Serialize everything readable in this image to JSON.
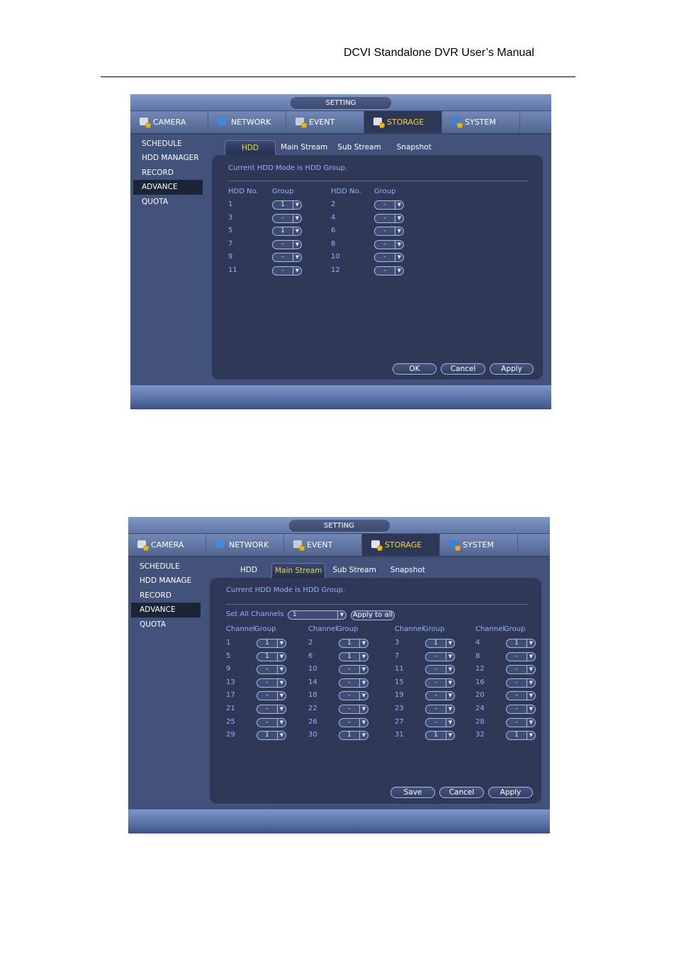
{
  "document": {
    "header": "DCVI Standalone DVR User’s Manual"
  },
  "screens": [
    {
      "title": "SETTING",
      "main_tabs": [
        {
          "label": "CAMERA",
          "icon": "camera-icon"
        },
        {
          "label": "NETWORK",
          "icon": "network-icon"
        },
        {
          "label": "EVENT",
          "icon": "event-icon"
        },
        {
          "label": "STORAGE",
          "icon": "storage-icon",
          "active": true
        },
        {
          "label": "SYSTEM",
          "icon": "system-icon"
        }
      ],
      "side_menu": [
        "SCHEDULE",
        "HDD MANAGER",
        "RECORD",
        "ADVANCE",
        "QUOTA"
      ],
      "side_active": "ADVANCE",
      "sub_tabs": [
        "HDD",
        "Main Stream",
        "Sub Stream",
        "Snapshot"
      ],
      "sub_active": "HDD",
      "mode_text": "Current HDD Mode is HDD Group.",
      "col_headers": {
        "no": "HDD No.",
        "group": "Group"
      },
      "rows": [
        {
          "a_no": "1",
          "a_group": "1",
          "b_no": "2",
          "b_group": "-"
        },
        {
          "a_no": "3",
          "a_group": "-",
          "b_no": "4",
          "b_group": "-"
        },
        {
          "a_no": "5",
          "a_group": "1",
          "b_no": "6",
          "b_group": "-"
        },
        {
          "a_no": "7",
          "a_group": "-",
          "b_no": "8",
          "b_group": "-"
        },
        {
          "a_no": "9",
          "a_group": "-",
          "b_no": "10",
          "b_group": "-"
        },
        {
          "a_no": "11",
          "a_group": "-",
          "b_no": "12",
          "b_group": "-"
        }
      ],
      "buttons": {
        "ok": "OK",
        "cancel": "Cancel",
        "apply": "Apply"
      }
    },
    {
      "title": "SETTING",
      "main_tabs": [
        {
          "label": "CAMERA",
          "icon": "camera-icon"
        },
        {
          "label": "NETWORK",
          "icon": "network-icon"
        },
        {
          "label": "EVENT",
          "icon": "event-icon"
        },
        {
          "label": "STORAGE",
          "icon": "storage-icon",
          "active": true
        },
        {
          "label": "SYSTEM",
          "icon": "system-icon"
        }
      ],
      "side_menu": [
        "SCHEDULE",
        "HDD MANAGE",
        "RECORD",
        "ADVANCE",
        "QUOTA"
      ],
      "side_active": "ADVANCE",
      "sub_tabs": [
        "HDD",
        "Main Stream",
        "Sub Stream",
        "Snapshot"
      ],
      "sub_active": "Main Stream",
      "mode_text": "Current HDD Mode is HDD Group.",
      "set_all": {
        "label": "Set All Channels",
        "value": "1",
        "apply_label": "Apply to all"
      },
      "col_headers": {
        "channel": "Channel",
        "group": "Group"
      },
      "channels": [
        {
          "ch": "1",
          "group": "1"
        },
        {
          "ch": "2",
          "group": "1"
        },
        {
          "ch": "3",
          "group": "1"
        },
        {
          "ch": "4",
          "group": "1"
        },
        {
          "ch": "5",
          "group": "1"
        },
        {
          "ch": "6",
          "group": "1"
        },
        {
          "ch": "7",
          "group": "-"
        },
        {
          "ch": "8",
          "group": "-"
        },
        {
          "ch": "9",
          "group": "-"
        },
        {
          "ch": "10",
          "group": "-"
        },
        {
          "ch": "11",
          "group": "-"
        },
        {
          "ch": "12",
          "group": "-"
        },
        {
          "ch": "13",
          "group": "-"
        },
        {
          "ch": "14",
          "group": "-"
        },
        {
          "ch": "15",
          "group": "-"
        },
        {
          "ch": "16",
          "group": "-"
        },
        {
          "ch": "17",
          "group": "-"
        },
        {
          "ch": "18",
          "group": "-"
        },
        {
          "ch": "19",
          "group": "-"
        },
        {
          "ch": "20",
          "group": "-"
        },
        {
          "ch": "21",
          "group": "-"
        },
        {
          "ch": "22",
          "group": "-"
        },
        {
          "ch": "23",
          "group": "-"
        },
        {
          "ch": "24",
          "group": "-"
        },
        {
          "ch": "25",
          "group": "-"
        },
        {
          "ch": "26",
          "group": "-"
        },
        {
          "ch": "27",
          "group": "-"
        },
        {
          "ch": "28",
          "group": "-"
        },
        {
          "ch": "29",
          "group": "1"
        },
        {
          "ch": "30",
          "group": "1"
        },
        {
          "ch": "31",
          "group": "1"
        },
        {
          "ch": "32",
          "group": "1"
        }
      ],
      "buttons": {
        "save": "Save",
        "cancel": "Cancel",
        "apply": "Apply"
      }
    }
  ],
  "colors": {
    "active_text": "#f2d23a",
    "label_blue": "#8fb2ff",
    "panel_bg": "#2f3957",
    "frame_bg": "#43527a"
  }
}
